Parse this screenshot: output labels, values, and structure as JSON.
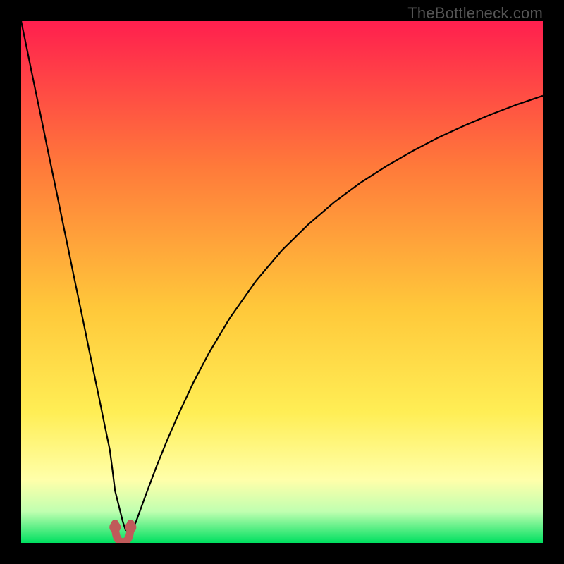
{
  "watermark": {
    "text": "TheBottleneck.com"
  },
  "colors": {
    "top": "#ff1f4e",
    "mid1": "#ff7a3a",
    "mid2": "#ffc83a",
    "mid3": "#ffee55",
    "paleYellow": "#ffffaa",
    "paleGreen": "#c0ffb0",
    "green": "#00e060",
    "curve": "#000000",
    "marker": "#c05a5a",
    "frame": "#000000"
  },
  "chart_data": {
    "type": "line",
    "title": "",
    "xlabel": "",
    "ylabel": "",
    "xlim": [
      0,
      100
    ],
    "ylim": [
      0,
      100
    ],
    "x": [
      0,
      1,
      2,
      3,
      4,
      5,
      6,
      7,
      8,
      9,
      10,
      11,
      12,
      13,
      14,
      15,
      16,
      16.5,
      17,
      17.5,
      18,
      18.5,
      19,
      19.5,
      20,
      21,
      22,
      24,
      26,
      28,
      30,
      33,
      36,
      40,
      45,
      50,
      55,
      60,
      65,
      70,
      75,
      80,
      85,
      90,
      95,
      100
    ],
    "values": [
      100,
      95.2,
      90.3,
      85.5,
      80.7,
      75.8,
      71.0,
      66.2,
      61.3,
      56.5,
      51.6,
      46.8,
      42.0,
      37.1,
      32.3,
      27.5,
      22.6,
      20.2,
      17.8,
      14.0,
      10.0,
      8.0,
      6.0,
      4.0,
      2.5,
      2.0,
      4.0,
      9.5,
      14.8,
      19.7,
      24.3,
      30.7,
      36.4,
      43.1,
      50.2,
      56.1,
      61.0,
      65.3,
      69.0,
      72.2,
      75.1,
      77.7,
      80.0,
      82.1,
      84.0,
      85.7
    ],
    "marker_points": [
      {
        "x": 18.0,
        "y": 3.0
      },
      {
        "x": 21.0,
        "y": 3.0
      }
    ],
    "marker_trough": {
      "x_start": 18.0,
      "x_end": 21.0,
      "y": 1.5
    }
  }
}
